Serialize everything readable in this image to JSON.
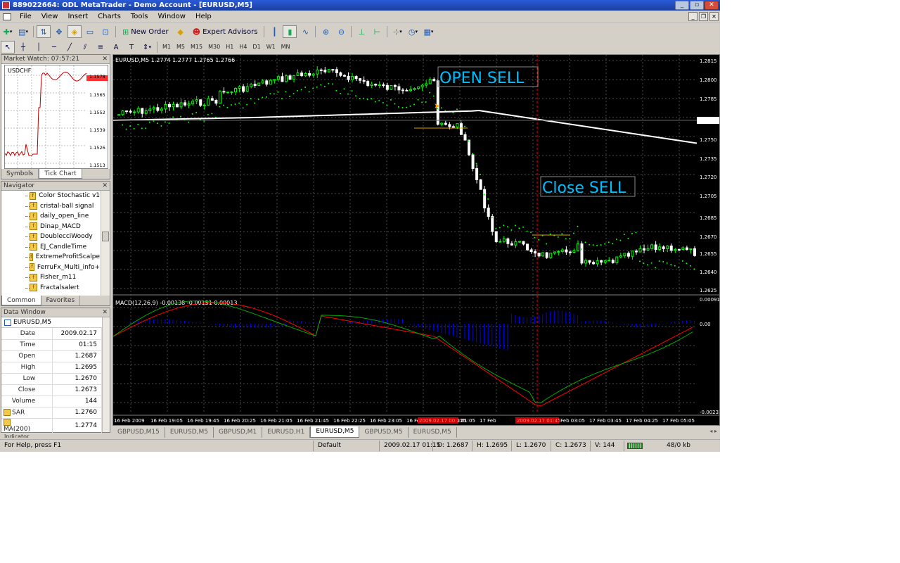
{
  "window": {
    "title": "889022664: ODL MetaTrader - Demo Account - [EURUSD,M5]"
  },
  "menu": [
    "File",
    "View",
    "Insert",
    "Charts",
    "Tools",
    "Window",
    "Help"
  ],
  "toolbar": {
    "new_order": "New Order",
    "expert_advisors": "Expert Advisors"
  },
  "timeframes": [
    "M1",
    "M5",
    "M15",
    "M30",
    "H1",
    "H4",
    "D1",
    "W1",
    "MN"
  ],
  "market_watch": {
    "title": "Market Watch: 07:57:21",
    "symbol": "USDCHF",
    "price_labels": [
      "1.1578",
      "1.1565",
      "1.1552",
      "1.1539",
      "1.1526",
      "1.1513"
    ],
    "tabs": [
      "Symbols",
      "Tick Chart"
    ]
  },
  "navigator": {
    "title": "Navigator",
    "items": [
      "Color Stochastic v1",
      "cristal-ball signal",
      "daily_open_line",
      "Dinap_MACD",
      "DoublecciWoody",
      "EJ_CandleTime",
      "ExtremeProfitScalpe",
      "FerruFx_Multi_info+",
      "Fisher_m11",
      "Fractalsalert"
    ],
    "tabs": [
      "Common",
      "Favorites"
    ]
  },
  "data_window": {
    "title": "Data Window",
    "symbol": "EURUSD,M5",
    "rows": [
      {
        "k": "Date",
        "v": "2009.02.17"
      },
      {
        "k": "Time",
        "v": "01:15"
      },
      {
        "k": "Open",
        "v": "1.2687"
      },
      {
        "k": "High",
        "v": "1.2695"
      },
      {
        "k": "Low",
        "v": "1.2670"
      },
      {
        "k": "Close",
        "v": "1.2673"
      },
      {
        "k": "Volume",
        "v": "144"
      },
      {
        "k": "SAR",
        "v": "1.2760"
      },
      {
        "k": "MA(200)",
        "v": "1.2774"
      }
    ],
    "clipped_row": "Indicator..."
  },
  "chart": {
    "header": "EURUSD,M5  1.2774 1.2777 1.2765 1.2766",
    "price_labels": [
      "1.2815",
      "1.2800",
      "1.2785",
      "1.2766",
      "1.2750",
      "1.2735",
      "1.2720",
      "1.2705",
      "1.2685",
      "1.2670",
      "1.2655",
      "1.2640",
      "1.2625"
    ],
    "annotations": {
      "open": "OPEN SELL",
      "close": "Close SELL"
    },
    "macd_header": "MACD(12,26,9) -0.00138 -0.00151 0.00013",
    "macd_labels": [
      "0.00091",
      "0.00",
      "-0.00232"
    ],
    "time_labels": [
      "16 Feb 2009",
      "16 Feb 19:05",
      "16 Feb 19:45",
      "16 Feb 20:25",
      "16 Feb 21:05",
      "16 Feb 21:45",
      "16 Feb 22:25",
      "16 Feb 23:05",
      "16 Feb",
      "17 Feb 01:05",
      "17 Feb",
      "17 Feb 02:25",
      "17 Feb 03:05",
      "17 Feb 03:45",
      "17 Feb 04:25",
      "17 Feb 05:05"
    ],
    "time_marker_1": "2009.02.17 00:25",
    "time_marker_2": "2009.02.17 01:45",
    "time_marker_1_tail": ":25",
    "colors": {
      "bull": "#00ff00",
      "bear": "#ffffff",
      "ma": "#ffffff",
      "sar": "#00ff00",
      "annotation": "#00bfff",
      "macd_hist": "#0000ff",
      "macd_signal": "#ff0000",
      "macd_line": "#00aa00",
      "marker": "#ff0000"
    }
  },
  "chart_tabs": [
    "GBPUSD,M15",
    "EURUSD,M5",
    "GBPUSD,M1",
    "EURUSD,H1",
    "EURUSD,M5",
    "GBPUSD,M5",
    "EURUSD,M5"
  ],
  "chart_tabs_active": 4,
  "statusbar": {
    "help": "For Help, press F1",
    "profile": "Default",
    "datetime": "2009.02.17 01:15",
    "open": "O: 1.2687",
    "high": "H: 1.2695",
    "low": "L: 1.2670",
    "close": "C: 1.2673",
    "volume": "V: 144",
    "traffic": "48/0 kb"
  }
}
